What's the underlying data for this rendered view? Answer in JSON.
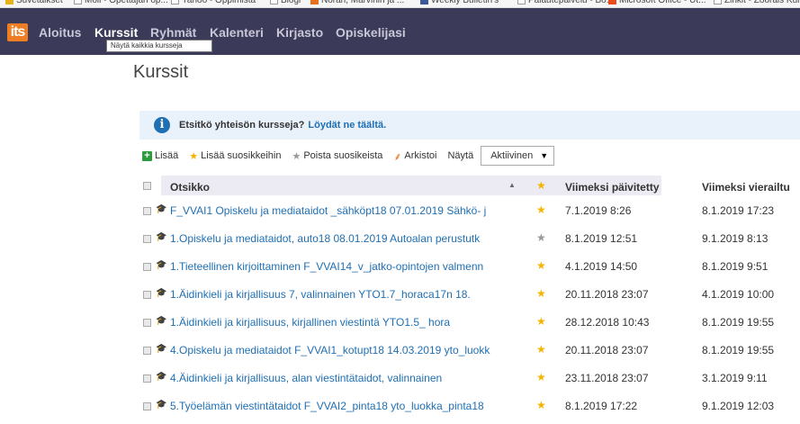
{
  "colors": {
    "nav_bg": "#3b3a58",
    "brand": "#ee7d23",
    "link": "#1f6fb3",
    "star_active": "#f5b400",
    "star_inactive": "#999999",
    "info_bg": "#e9f2fa"
  },
  "bookmarks": [
    {
      "label": "Suvetaikset",
      "icon": "folder-icon"
    },
    {
      "label": "Moli - Opettajan op...",
      "icon": "page-icon"
    },
    {
      "label": "Yahoo - Oppimista",
      "icon": "page-icon"
    },
    {
      "label": "Blogi",
      "icon": "page-icon"
    },
    {
      "label": "Norah, Marvinin ja ...",
      "icon": "blogger-icon"
    },
    {
      "label": "Weekly Bulletin's",
      "icon": "facebook-icon"
    },
    {
      "label": "Palautepalvelu - Bo...",
      "icon": "page-icon"
    },
    {
      "label": "Microsoft Office - Ut...",
      "icon": "office-icon"
    },
    {
      "label": "Zinkit - Zoorais Kun...",
      "icon": "page-icon"
    }
  ],
  "nav": {
    "logo": "its",
    "items": [
      "Aloitus",
      "Kurssit",
      "Ryhmät",
      "Kalenteri",
      "Kirjasto",
      "Opiskelijasi"
    ],
    "active": "Kurssit",
    "tooltip": "Näytä kaikkia kursseja"
  },
  "page_title": "Kurssit",
  "info": {
    "icon": "info-icon",
    "text": "Etsitkö yhteisön kursseja?",
    "link": "Löydät ne täältä."
  },
  "toolbar": {
    "add": "Lisää",
    "add_fav": "Lisää suosikkeihin",
    "remove_fav": "Poista suosikeista",
    "archive": "Arkistoi",
    "show_label": "Näytä",
    "show_value": "Aktiivinen"
  },
  "table": {
    "headers": {
      "title": "Otsikko",
      "updated": "Viimeksi päivitetty",
      "visited": "Viimeksi vierailtu"
    },
    "rows": [
      {
        "title": "F_VVAI1 Opiskelu ja mediataidot _sähköpt18 07.01.2019 Sähkö- j",
        "favorite": true,
        "updated": "7.1.2019 8:26",
        "visited": "8.1.2019 17:23"
      },
      {
        "title": "1.Opiskelu ja mediataidot, auto18 08.01.2019 Autoalan perustutk",
        "favorite": false,
        "updated": "8.1.2019 12:51",
        "visited": "9.1.2019 8:13"
      },
      {
        "title": "1.Tieteellinen kirjoittaminen F_VVAI14_v_jatko-opintojen valmenn",
        "favorite": true,
        "updated": "4.1.2019 14:50",
        "visited": "8.1.2019 9:51"
      },
      {
        "title": "1.Äidinkieli ja kirjallisuus 7, valinnainen YTO1.7_horaca17n 18.",
        "favorite": true,
        "updated": "20.11.2018 23:07",
        "visited": "4.1.2019 10:00"
      },
      {
        "title": "1.Äidinkieli ja kirjallisuus, kirjallinen viestintä YTO1.5_ hora",
        "favorite": true,
        "updated": "28.12.2018 10:43",
        "visited": "8.1.2019 19:55"
      },
      {
        "title": "4.Opiskelu ja mediataidot F_VVAI1_kotupt18 14.03.2019 yto_luokk",
        "favorite": true,
        "updated": "20.11.2018 23:07",
        "visited": "8.1.2019 19:55"
      },
      {
        "title": "4.Äidinkieli ja kirjallisuus, alan viestintätaidot, valinnainen",
        "favorite": true,
        "updated": "23.11.2018 23:07",
        "visited": "3.1.2019 9:11"
      },
      {
        "title": "5.Työelämän viestintätaidot F_VVAI2_pinta18 yto_luokka_pinta18",
        "favorite": true,
        "updated": "8.1.2019 17:22",
        "visited": "9.1.2019 12:03"
      }
    ]
  }
}
